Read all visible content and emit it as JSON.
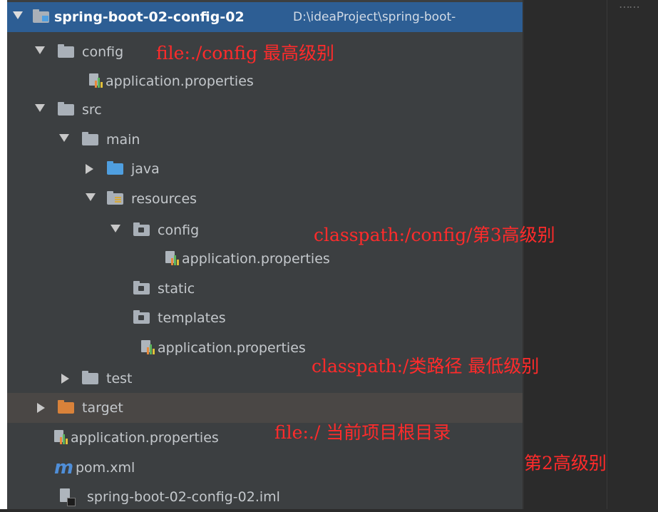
{
  "project_tree": {
    "root": {
      "name": "spring-boot-02-config-02",
      "path": "D:\\ideaProject\\spring-boot-"
    },
    "config_folder": "config",
    "config_props": "application.properties",
    "src_folder": "src",
    "main_folder": "main",
    "java_folder": "java",
    "resources_folder": "resources",
    "res_config_folder": "config",
    "res_config_props": "application.properties",
    "static_folder": "static",
    "templates_folder": "templates",
    "res_props": "application.properties",
    "test_folder": "test",
    "target_folder": "target",
    "root_props": "application.properties",
    "pom": "pom.xml",
    "iml": "spring-boot-02-config-02.iml"
  },
  "annotations": {
    "config_dir": "file:./config  最高级别",
    "classpath_config": "classpath:/config/第3高级别",
    "classpath_root": "classpath:/类路径 最低级别",
    "project_root": "file:./ 当前项目根目录",
    "project_root_level": "第2高级别"
  },
  "icons": [
    "expand-arrow-icon",
    "collapse-arrow-icon",
    "folder-icon",
    "source-folder-icon",
    "resources-folder-icon",
    "excluded-folder-icon",
    "properties-file-icon",
    "maven-icon",
    "iml-file-icon"
  ],
  "colors": {
    "selection": "#2d5e94",
    "annotation": "#ff2b2b",
    "excluded_row": "#4a4745"
  }
}
